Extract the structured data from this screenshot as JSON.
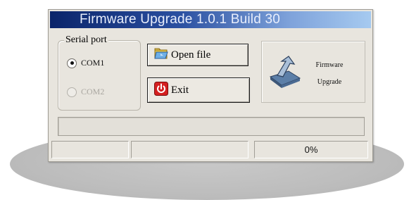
{
  "window": {
    "title": "Firmware Upgrade 1.0.1 Build 30"
  },
  "serial_port": {
    "label": "Serial port",
    "options": [
      {
        "label": "COM1",
        "selected": true,
        "enabled": true
      },
      {
        "label": "COM2",
        "selected": false,
        "enabled": false
      }
    ]
  },
  "buttons": {
    "open_file": "Open file",
    "exit": "Exit",
    "firmware_upgrade_line1": "Firmware",
    "firmware_upgrade_line2": "Upgrade"
  },
  "icons": {
    "open_file": "open-folder-icon",
    "exit": "power-icon",
    "firmware_upgrade": "upload-arrow-icon"
  },
  "status": {
    "cell1": "",
    "cell2": "",
    "percent": "0%"
  },
  "progress": {
    "value": 0
  },
  "colors": {
    "title_gradient_start": "#0a246a",
    "title_gradient_end": "#a6caf0",
    "window_face": "#e8e5de",
    "exit_icon_red": "#d42020"
  }
}
